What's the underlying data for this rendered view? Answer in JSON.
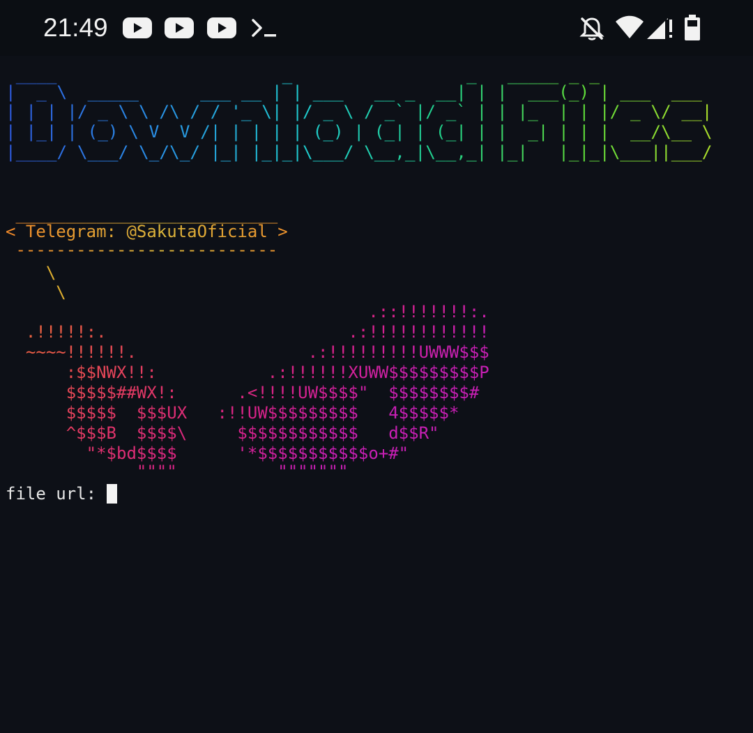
{
  "statusbar": {
    "time": "21:49",
    "icons": [
      "youtube-icon",
      "youtube-icon",
      "youtube-icon",
      "terminal-icon",
      "bell-off-icon",
      "wifi-icon",
      "signal-icon",
      "battery-icon"
    ]
  },
  "banner": {
    "lines": [
      " ____                      _                 _   _____ _ _           ",
      "|  _ \\  _____      ___ __ | | ___   __ _  __| | |  ___(_) | ___  ___ ",
      "| | | |/ _ \\ \\ /\\ / / '_ \\| |/ _ \\ / _` |/ _` | | |_  | | |/ _ \\/ __|",
      "| |_| | (_) \\ V  V /| | | | | (_) | (_| | (_| | |  _| | | |  __/\\__ \\",
      "|____/ \\___/ \\_/\\_/ |_| |_|_|\\___/ \\__,_|\\__,_| |_|   |_|_|\\___||___/"
    ],
    "colors": [
      "#2f5de0",
      "#2a8fe6",
      "#1fc9d0",
      "#22d18a",
      "#5fdc3a",
      "#b7df2a"
    ]
  },
  "cowsay": {
    "bubble_top": " __________________________",
    "message": "< Telegram: @SakutaOficial >",
    "bubble_bottom": " --------------------------",
    "tail": [
      "    \\",
      "     \\"
    ],
    "whale": [
      "                                    .::!!!!!!!:.",
      "  .!!!!!:.                        .:!!!!!!!!!!!!",
      "  ~~~~!!!!!!.                 .:!!!!!!!!!UWWW$$$",
      "      :$$NWX!!:           .:!!!!!!XUWW$$$$$$$$$P",
      "      $$$$$##WX!:      .<!!!!UW$$$$\"  $$$$$$$$#",
      "      $$$$$  $$$UX   :!!UW$$$$$$$$$   4$$$$$*",
      "      ^$$$B  $$$$\\     $$$$$$$$$$$$   d$$R\"",
      "        \"*$bd$$$$      '*$$$$$$$$$$$o+#\"",
      "             \"\"\"\"          \"\"\"\"\"\"\""
    ],
    "gradient": [
      "#f08a2a",
      "#ee6f3a",
      "#e8504d",
      "#e0346a",
      "#d7228a",
      "#c81fb4"
    ]
  },
  "prompt": {
    "label": "file url: ",
    "value": ""
  }
}
